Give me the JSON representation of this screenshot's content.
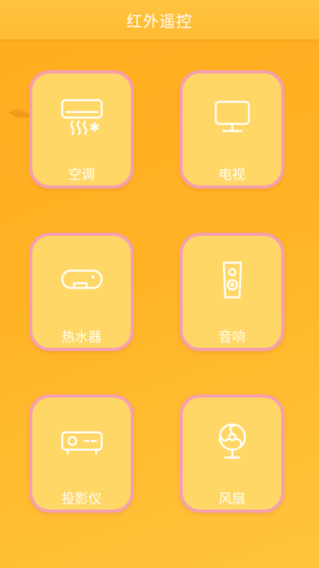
{
  "header": {
    "title": "红外遥控"
  },
  "colors": {
    "accent": "#ffb324",
    "card": "#ffd766",
    "card_border": "#f5a0b0",
    "text": "#ffffff"
  },
  "devices": [
    {
      "label": "空调",
      "icon": "air-conditioner-icon"
    },
    {
      "label": "电视",
      "icon": "tv-icon"
    },
    {
      "label": "热水器",
      "icon": "water-heater-icon"
    },
    {
      "label": "音响",
      "icon": "speaker-icon"
    },
    {
      "label": "投影仪",
      "icon": "projector-icon"
    },
    {
      "label": "风扇",
      "icon": "fan-icon"
    }
  ]
}
